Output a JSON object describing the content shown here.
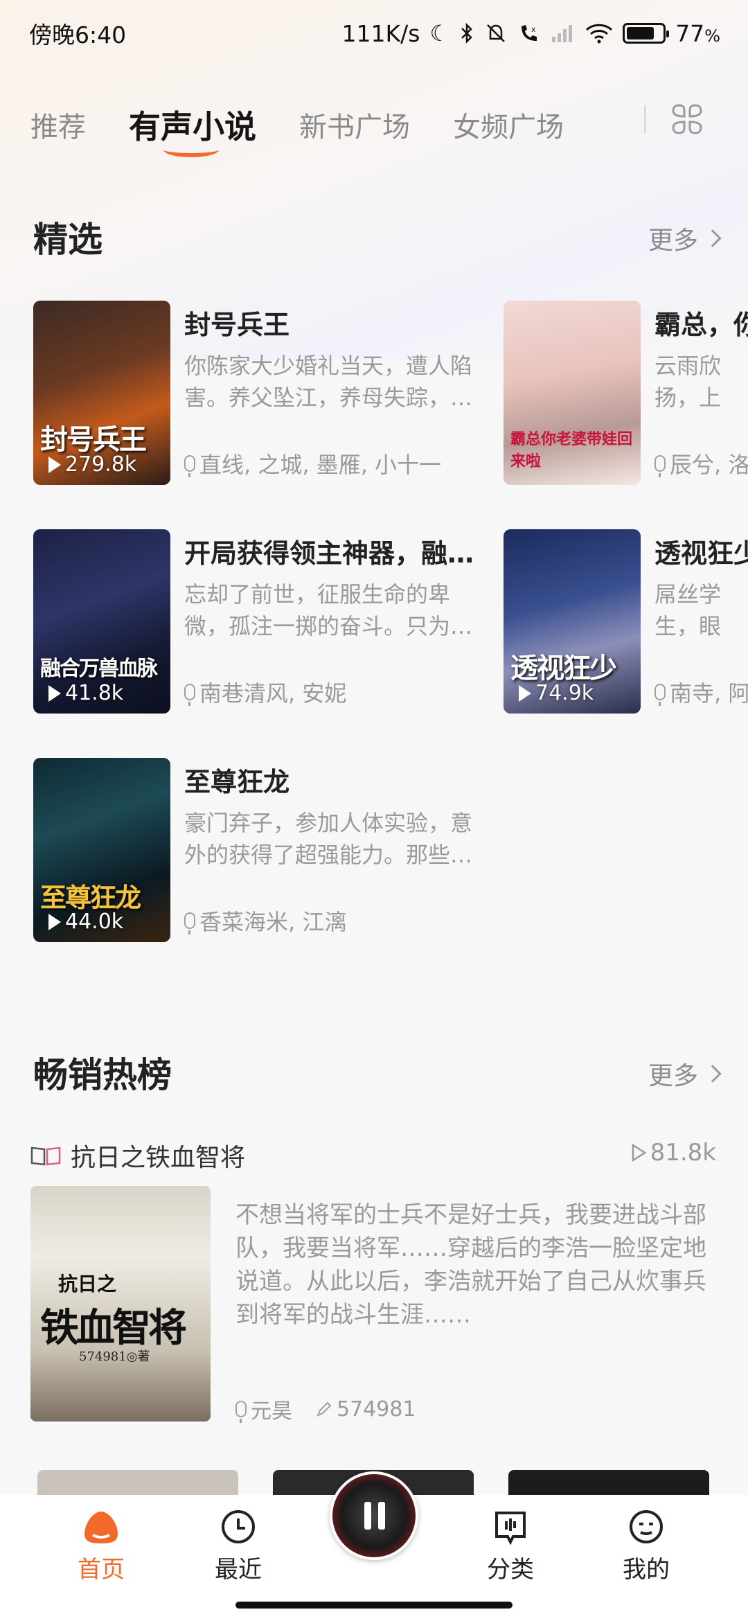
{
  "status_bar": {
    "time": "傍晚6:40",
    "network_speed": "111K/s",
    "battery_percent": "77",
    "battery_level": 0.77,
    "icons": [
      "moon-icon",
      "bluetooth-icon",
      "mute-icon",
      "hd-call-icon",
      "signal-icon",
      "wifi-icon",
      "battery-icon"
    ]
  },
  "tabs": [
    {
      "label": "推荐",
      "active": false
    },
    {
      "label": "有声小说",
      "active": true
    },
    {
      "label": "新书广场",
      "active": false
    },
    {
      "label": "女频广场",
      "active": false
    }
  ],
  "featured": {
    "title": "精选",
    "more_label": "更多",
    "books": [
      {
        "title": "封号兵王",
        "desc": "你陈家大少婚礼当天，遭人陷害。养父坠江，养母失踪，…",
        "narrators": "直线, 之城, 墨雁, 小十一",
        "plays": "279.8k",
        "cover_text": "封号兵王"
      },
      {
        "title": "霸总，你",
        "desc": "云雨欣扬，上有钱有",
        "narrators": "辰兮, 洛",
        "plays": "",
        "cover_text": "霸总你老婆带娃回来啦"
      },
      {
        "title": "开局获得领主神器，融…",
        "desc": "忘却了前世，征服生命的卑微，孤注一掷的奋斗。只为…",
        "narrators": "南巷清风, 安妮",
        "plays": "41.8k",
        "cover_text": "融合万兽血脉"
      },
      {
        "title": "透视狂少",
        "desc": "屌丝学生，眼开。隔",
        "narrators": "南寺, 阿",
        "plays": "74.9k",
        "cover_text": "透视狂少"
      },
      {
        "title": "至尊狂龙",
        "desc": "豪门弃子，参加人体实验，意外的获得了超强能力。那些…",
        "narrators": "香菜海米, 江漓",
        "plays": "44.0k",
        "cover_text": "至尊狂龙"
      }
    ]
  },
  "bestseller": {
    "title": "畅销热榜",
    "more_label": "更多",
    "top_book": {
      "title": "抗日之铁血智将",
      "plays": "81.8k",
      "desc": "不想当将军的士兵不是好士兵，我要进战斗部队，我要当将军……穿越后的李浩一脸坚定地说道。从此以后，李浩就开始了自己从炊事兵到将军的战斗生涯……",
      "narrator": "元昊",
      "author": "574981",
      "cover_title_top": "抗日之",
      "cover_title_main": "铁血智将",
      "cover_author": "574981◎著"
    }
  },
  "bottom_nav": [
    {
      "label": "首页",
      "icon": "home-icon",
      "active": true
    },
    {
      "label": "最近",
      "icon": "clock-icon",
      "active": false
    },
    {
      "label": "分类",
      "icon": "category-icon",
      "active": false
    },
    {
      "label": "我的",
      "icon": "profile-icon",
      "active": false
    }
  ],
  "colors": {
    "accent": "#f26a2a",
    "text_primary": "#222222",
    "text_secondary": "#9a9a9a"
  }
}
